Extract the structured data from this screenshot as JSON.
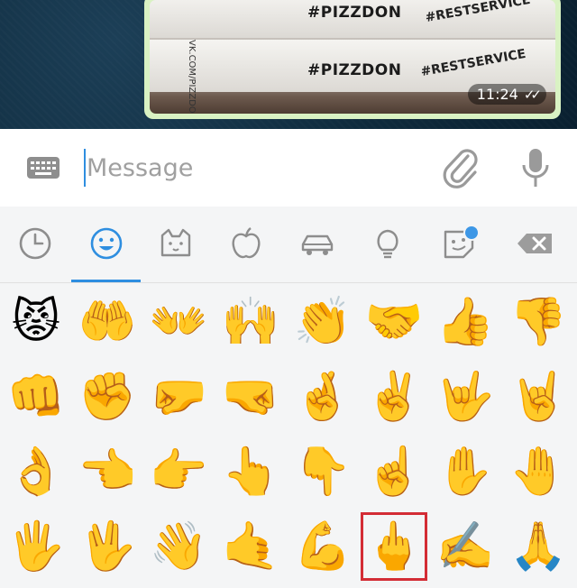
{
  "chat": {
    "photo": {
      "brand_text": "#PIZZDON",
      "service_text": "#RESTSERVICE",
      "site_text": "VK.COM/PIZZDON",
      "time": "11:24",
      "ticks": "✓✓"
    }
  },
  "input": {
    "placeholder": "Message",
    "value": ""
  },
  "tabs": [
    {
      "name": "recent",
      "icon": "clock-icon",
      "active": false
    },
    {
      "name": "smileys",
      "icon": "smiley-icon",
      "active": true
    },
    {
      "name": "animals",
      "icon": "cat-icon",
      "active": false
    },
    {
      "name": "food",
      "icon": "apple-icon",
      "active": false
    },
    {
      "name": "travel",
      "icon": "car-icon",
      "active": false
    },
    {
      "name": "objects",
      "icon": "lightbulb-icon",
      "active": false
    },
    {
      "name": "stickers",
      "icon": "sticker-icon",
      "active": false,
      "badge": true
    },
    {
      "name": "backspace",
      "icon": "backspace-icon"
    }
  ],
  "emoji_rows": [
    [
      "😾",
      "🤲",
      "👐",
      "🙌",
      "👏",
      "🤝",
      "👍",
      "👎"
    ],
    [
      "👊",
      "✊",
      "🤛",
      "🤜",
      "🤞",
      "✌️",
      "🤟",
      "🤘"
    ],
    [
      "👌",
      "👈",
      "👉",
      "👆",
      "👇",
      "☝️",
      "✋",
      "🤚"
    ],
    [
      "🖐",
      "🖖",
      "👋",
      "🤙",
      "💪",
      "🖕",
      "✍️",
      "🙏"
    ]
  ],
  "selected_emoji": {
    "row": 3,
    "col": 5
  },
  "colors": {
    "accent": "#2e8ee0",
    "selection": "#d32c35",
    "bubble": "#d9f2c3"
  }
}
